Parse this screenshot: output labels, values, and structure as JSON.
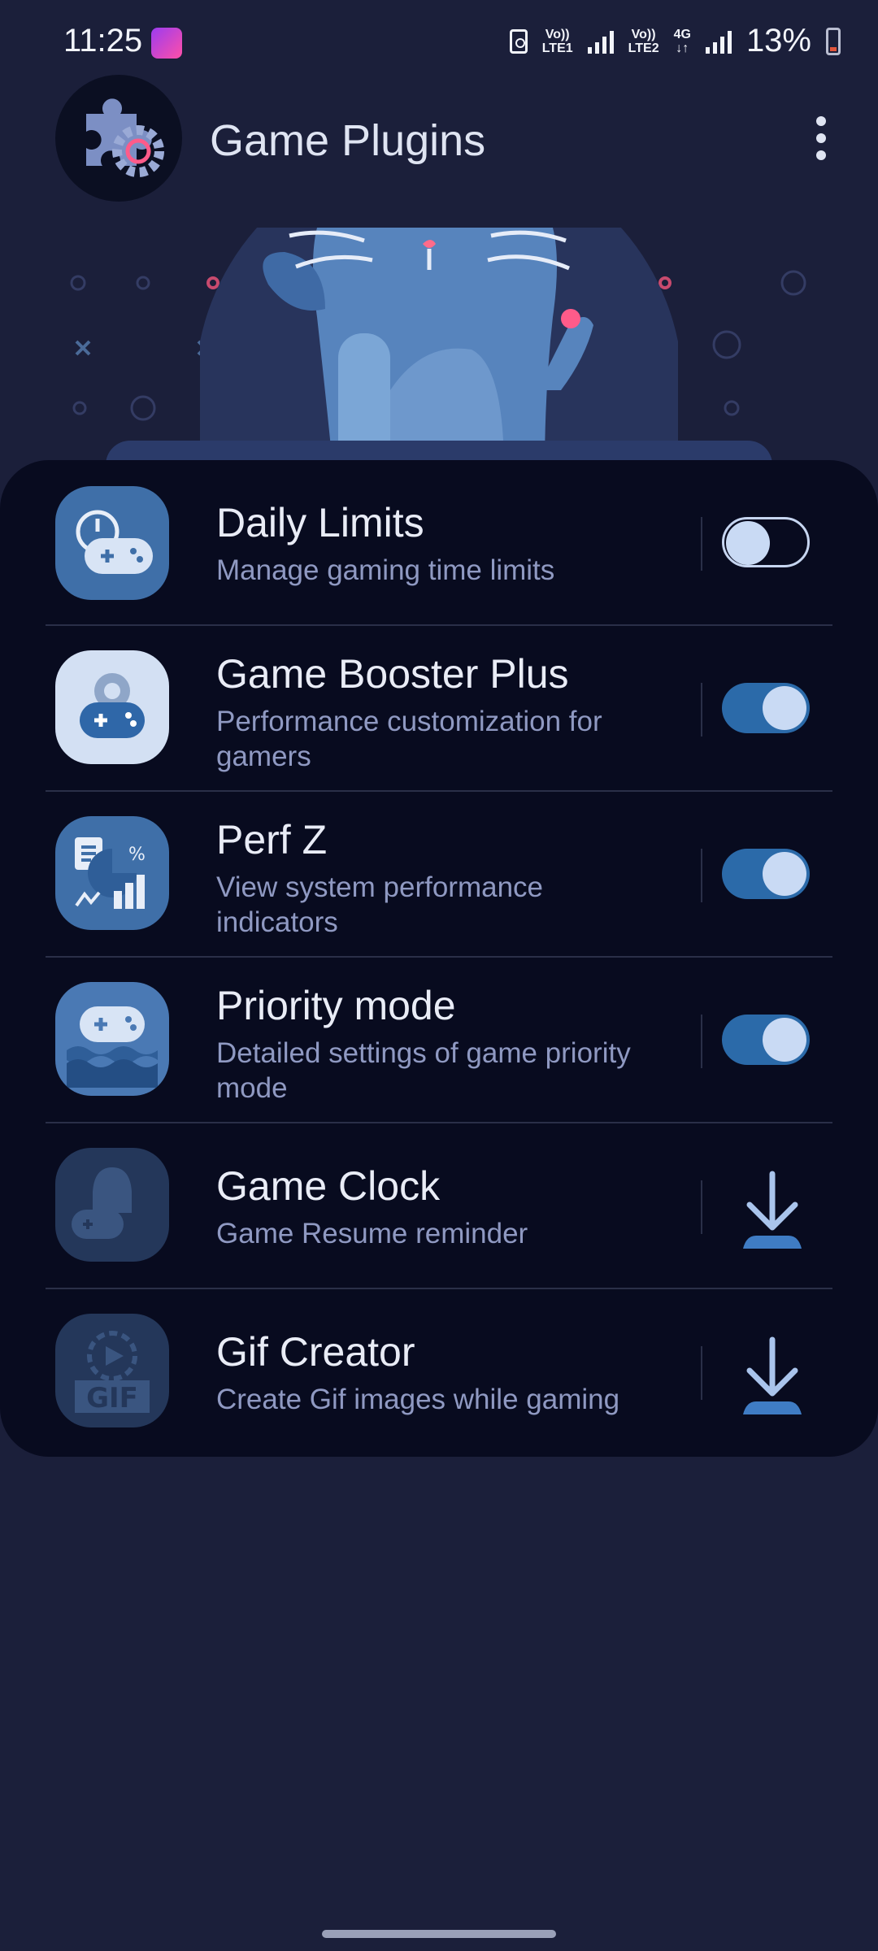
{
  "status_bar": {
    "time": "11:25",
    "sim1_label_top": "Vo))",
    "sim1_label_bottom": "LTE1",
    "sim2_label_top": "Vo))",
    "sim2_label_bottom": "LTE2",
    "network": "4G",
    "battery": "13%"
  },
  "header": {
    "title": "Game Plugins",
    "more_icon": "more-vert-icon"
  },
  "plugins": [
    {
      "name": "Daily Limits",
      "description": "Manage gaming time limits",
      "control": "toggle",
      "enabled": false
    },
    {
      "name": "Game Booster Plus",
      "description": "Performance customization for gamers",
      "control": "toggle",
      "enabled": true
    },
    {
      "name": "Perf Z",
      "description": "View system performance indicators",
      "control": "toggle",
      "enabled": true
    },
    {
      "name": "Priority mode",
      "description": "Detailed settings of game priority mode",
      "control": "toggle",
      "enabled": true
    },
    {
      "name": "Game Clock",
      "description": "Game Resume reminder",
      "control": "download"
    },
    {
      "name": "Gif Creator",
      "description": "Create Gif images while gaming",
      "control": "download",
      "icon_text": "GIF"
    }
  ],
  "colors": {
    "background": "#1b1f3a",
    "card": "#080b1f",
    "accent": "#2b6aa9",
    "knob": "#c9daf4"
  }
}
